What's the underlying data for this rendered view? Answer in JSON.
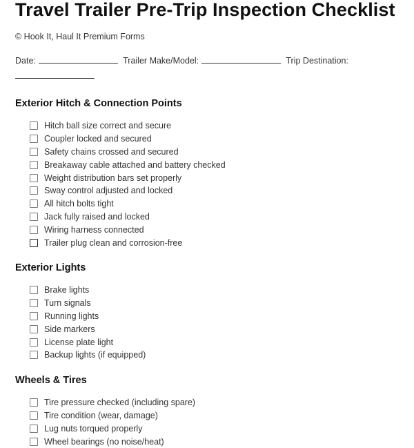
{
  "title": "Travel Trailer Pre-Trip Inspection Checklist",
  "copyright": "© Hook It, Haul It Premium Forms",
  "meta": {
    "date_label": "Date:",
    "model_label": "Trailer Make/Model:",
    "destination_label": "Trip Destination:"
  },
  "sections": [
    {
      "heading": "Exterior Hitch & Connection Points",
      "items": [
        "Hitch ball size correct and secure",
        "Coupler locked and secured",
        "Safety chains crossed and secured",
        "Breakaway cable attached and battery checked",
        "Weight distribution bars set properly",
        "Sway control adjusted and locked",
        "All hitch bolts tight",
        "Jack fully raised and locked",
        "Wiring harness connected",
        "Trailer plug clean and corrosion-free"
      ]
    },
    {
      "heading": "Exterior Lights",
      "items": [
        "Brake lights",
        "Turn signals",
        "Running lights",
        "Side markers",
        "License plate light",
        "Backup lights (if equipped)"
      ]
    },
    {
      "heading": "Wheels & Tires",
      "items": [
        "Tire pressure checked (including spare)",
        "Tire condition (wear, damage)",
        "Lug nuts torqued properly",
        "Wheel bearings (no noise/heat)"
      ]
    }
  ]
}
